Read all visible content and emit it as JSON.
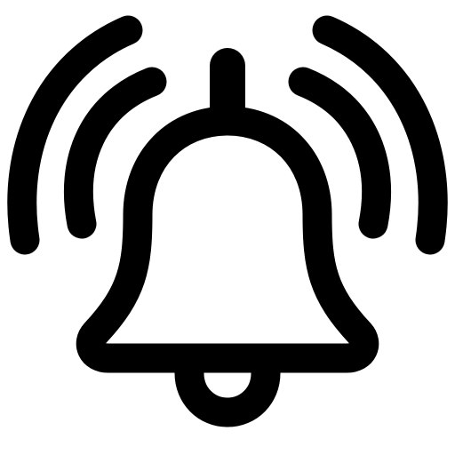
{
  "icon": {
    "name": "bell-ringing-icon",
    "color": "#000000",
    "background": "#ffffff"
  }
}
